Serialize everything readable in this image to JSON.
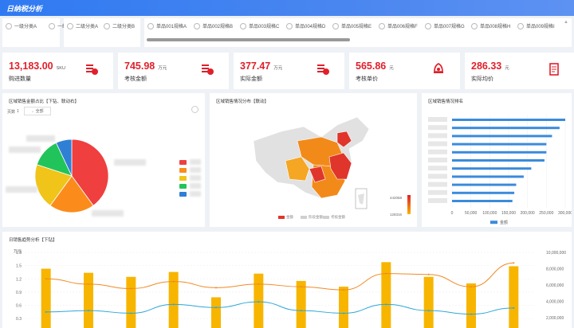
{
  "header": {
    "title": "日纳税分析"
  },
  "filters": {
    "group1": [
      "一级分类A",
      "一级"
    ],
    "group2": [
      "二级分类A",
      "二级分类B"
    ],
    "group3": [
      "单品001规格A",
      "单品002规格B",
      "单品003规格C",
      "单品004规格D",
      "单品005规格E",
      "单品006规格F",
      "单品007规格G",
      "单品008规格H",
      "单品009规格I"
    ]
  },
  "kpis": [
    {
      "value": "13,183.00",
      "unit": "SKU",
      "label": "购进数量",
      "icon": "invoice-icon",
      "color": "#e0202b"
    },
    {
      "value": "745.98",
      "unit": "万元",
      "label": "考核金额",
      "icon": "invoice-icon",
      "color": "#e0202b"
    },
    {
      "value": "377.47",
      "unit": "万元",
      "label": "实际金额",
      "icon": "invoice-icon",
      "color": "#e0202b"
    },
    {
      "value": "565.86",
      "unit": "元",
      "label": "考核单价",
      "icon": "bell-icon",
      "color": "#e0202b"
    },
    {
      "value": "286.33",
      "unit": "元",
      "label": "实际均价",
      "icon": "document-icon",
      "color": "#e0202b"
    }
  ],
  "pie_panel": {
    "title": "区域销售金额占比【下钻、联动右】",
    "page_label": "页数",
    "page_value": "1",
    "select_value": "全部"
  },
  "map_panel": {
    "title": "区域销售情况分布【联动】",
    "legend_max": "442058",
    "legend_min": "128316",
    "legend_items": [
      "金额",
      "阶段金额",
      "考核金额"
    ]
  },
  "rank_panel": {
    "title": "区域销售情况排名"
  },
  "trend_panel": {
    "title": "日销售趋势分析【下钻】",
    "y_unit": "万元"
  },
  "chart_data": [
    {
      "type": "pie",
      "title": "区域销售金额占比【下钻、联动右】",
      "values": [
        40,
        20,
        20,
        13,
        7
      ],
      "colors": [
        "#ef3f3f",
        "#fb8c1c",
        "#f0c419",
        "#21c45a",
        "#2f7fd5"
      ]
    },
    {
      "type": "bar",
      "title": "区域销售情况排名",
      "orientation": "horizontal",
      "values": [
        300000,
        285000,
        265000,
        250000,
        250000,
        245000,
        210000,
        190000,
        170000,
        165000,
        160000
      ],
      "xlim": [
        0,
        300000
      ],
      "xticks": [
        "0",
        "50,000",
        "100,000",
        "150,000",
        "200,000",
        "250,000",
        "300,000"
      ],
      "legend": [
        "金额"
      ],
      "color": "#3a8bdc"
    },
    {
      "type": "bar",
      "title": "日销售趋势分析【下钻】",
      "bars": [
        8000000,
        7500000,
        7000000,
        7600000,
        4500000,
        7400000,
        6500000,
        5800000,
        8800000,
        7000000,
        6200000,
        8300000
      ],
      "line_orange": [
        1.2,
        1.08,
        0.98,
        1.14,
        1.0,
        1.08,
        1.02,
        0.95,
        1.32,
        1.3,
        1.02,
        1.56
      ],
      "line_blue": [
        0.45,
        0.48,
        0.42,
        0.62,
        0.55,
        0.68,
        0.48,
        0.42,
        0.62,
        0.48,
        0.4,
        0.54
      ],
      "y_left_ticks": [
        "1.8",
        "1.5",
        "1.2",
        "0.9",
        "0.6",
        "0.3"
      ],
      "y_right_ticks": [
        "10,000,000",
        "8,000,000",
        "6,000,000",
        "4,000,000",
        "2,000,000"
      ],
      "bar_color": "#f7b500",
      "line_orange_color": "#f08a24",
      "line_blue_color": "#2ea7d8"
    }
  ]
}
